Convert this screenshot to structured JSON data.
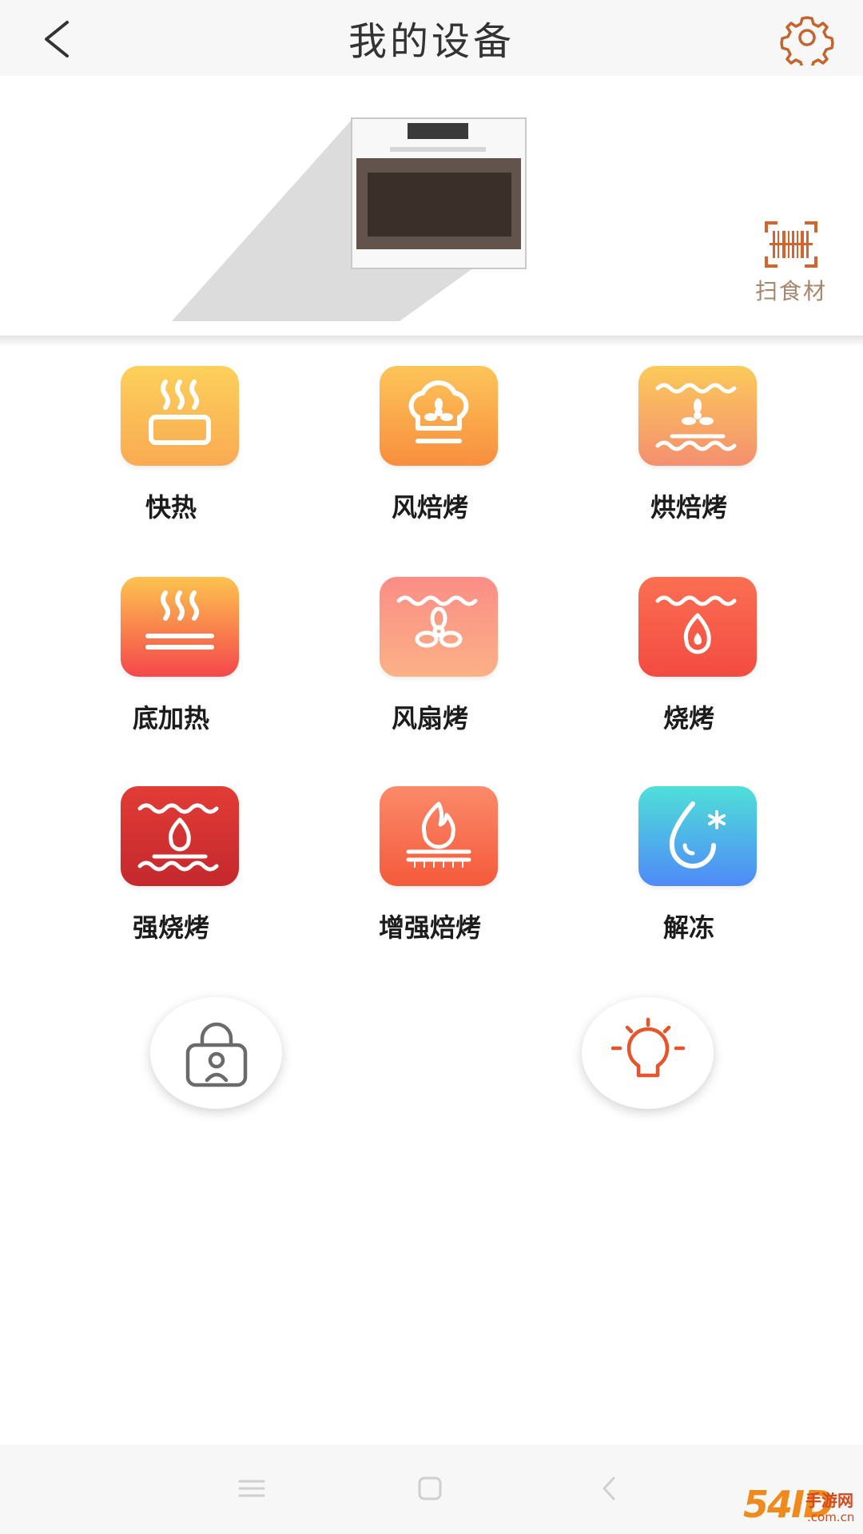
{
  "header": {
    "title": "我的设备",
    "back_icon": "chevron-left-icon",
    "settings_icon": "gear-icon"
  },
  "hero": {
    "scan_label": "扫食材",
    "scan_icon": "barcode-scan-icon"
  },
  "modes": [
    {
      "label": "快热",
      "icon": "quick-heat-icon",
      "colors": [
        "#fdd05b",
        "#f9aa52"
      ]
    },
    {
      "label": "风焙烤",
      "icon": "chef-hat-fan-icon",
      "colors": [
        "#fdc559",
        "#f88e3e"
      ]
    },
    {
      "label": "烘焙烤",
      "icon": "fan-top-bottom-heat-icon",
      "colors": [
        "#fcc95a",
        "#f49070"
      ]
    },
    {
      "label": "底加热",
      "icon": "bottom-heat-icon",
      "colors": [
        "#fdc34f",
        "#f5474b"
      ]
    },
    {
      "label": "风扇烤",
      "icon": "fan-grill-icon",
      "colors": [
        "#fb8d86",
        "#fbb186"
      ]
    },
    {
      "label": "烧烤",
      "icon": "flame-grill-icon",
      "colors": [
        "#fb6f52",
        "#f34b41"
      ]
    },
    {
      "label": "强烧烤",
      "icon": "strong-grill-icon",
      "colors": [
        "#e23c36",
        "#c4282d"
      ]
    },
    {
      "label": "增强焙烤",
      "icon": "enhanced-bake-icon",
      "colors": [
        "#fb8a6a",
        "#f45a3b"
      ]
    },
    {
      "label": "解冻",
      "icon": "defrost-icon",
      "colors": [
        "#4fe0d8",
        "#4f8af8"
      ]
    }
  ],
  "controls": {
    "lock_icon": "child-lock-icon",
    "light_icon": "light-bulb-icon"
  },
  "navbar": {
    "menu_icon": "menu-icon",
    "home_icon": "home-square-icon",
    "back_icon": "back-triangle-icon"
  },
  "watermark": {
    "number": "54ID",
    "text": "手游网",
    "domain": ".com.cn"
  }
}
